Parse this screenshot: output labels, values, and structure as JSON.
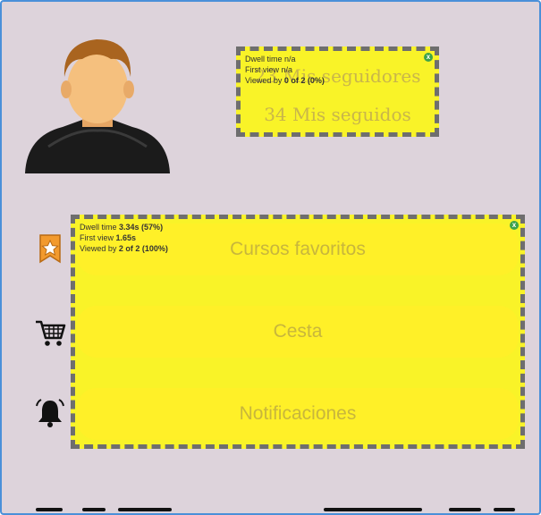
{
  "profile": {
    "followers_label": "23 Mis seguidores",
    "following_label": "34 Mis seguidos"
  },
  "heatmap_top": {
    "dwell_label": "Dwell time",
    "dwell_value": "n/a",
    "first_view_label": "First view",
    "first_view_value": "n/a",
    "viewed_label": "Viewed by",
    "viewed_value": "0 of 2 (0%)",
    "close": "x"
  },
  "heatmap_main": {
    "dwell_label": "Dwell time",
    "dwell_value": "3.34s (57%)",
    "first_view_label": "First view",
    "first_view_value": "1.65s",
    "viewed_label": "Viewed by",
    "viewed_value": "2 of 2 (100%)",
    "close": "x"
  },
  "menu": {
    "favorites_label": "Cursos favoritos",
    "cart_label": "Cesta",
    "notifications_label": "Notificaciones"
  },
  "icons": {
    "avatar": "user-avatar",
    "favorites": "bookmark-star-icon",
    "cart": "shopping-cart-icon",
    "notifications": "bell-icon"
  },
  "colors": {
    "background": "#ddd3db",
    "highlight": "#fff01e",
    "text_muted": "#c8b63c",
    "frame_border": "#4a90d9"
  }
}
